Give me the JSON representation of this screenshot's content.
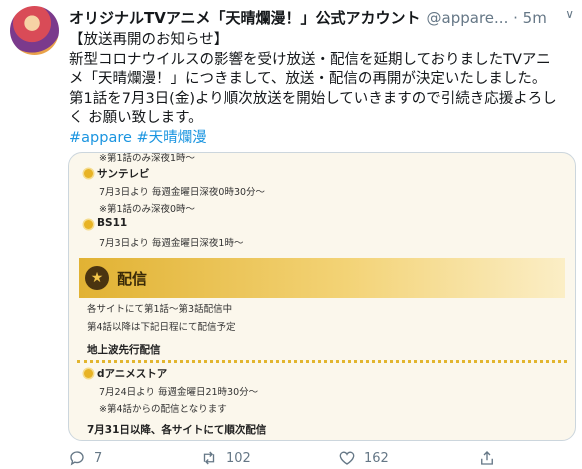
{
  "tweet": {
    "display_name": "オリジナルTVアニメ「天晴爛漫！」公式アカウント",
    "handle": "@appare...",
    "time": "· 5m",
    "text_lines": [
      "【放送再開のお知らせ】",
      "新型コロナウイルスの影響を受け放送・配信を延期しておりましたTVアニ",
      "メ「天晴爛漫！」につきまして、放送・配信の再開が決定いたしました。",
      "第1話を7月3日(金)より順次放送を開始していきますので引続き応援よろし",
      "く お願い致します。"
    ],
    "hashtags": [
      "#appare",
      "#天晴爛漫"
    ]
  },
  "card": {
    "top_partial": "※第1話のみ深夜1時〜",
    "channels": [
      {
        "name": "サンテレビ",
        "line1": "7月3日より 毎週金曜日深夜0時30分〜",
        "line2": "※第1話のみ深夜0時〜"
      },
      {
        "name": "BS11",
        "line1": "7月3日より 毎週金曜日深夜1時〜"
      }
    ],
    "section_title": "配信",
    "section_lines": [
      "各サイトにて第1話〜第3話配信中",
      "第4話以降は下記日程にて配信予定"
    ],
    "subheading": "地上波先行配信",
    "store": {
      "name": "dアニメストア",
      "line1": "7月24日より 毎週金曜日21時30分〜",
      "line2": "※第4話からの配信となります"
    },
    "bottom_heading": "7月31日以降、各サイトにて順次配信"
  },
  "actions": {
    "replies": "7",
    "retweets": "102",
    "likes": "162"
  }
}
